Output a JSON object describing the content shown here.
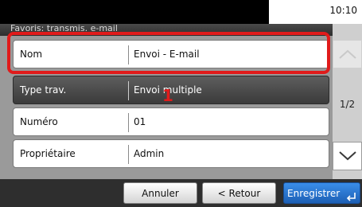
{
  "status": {
    "clock": "10:10"
  },
  "screen_title": "Favoris: transmis. e-mail",
  "rows": [
    {
      "label": "Nom",
      "value": "Envoi - E-mail",
      "selected": false
    },
    {
      "label": "Type trav.",
      "value": "Envoi multiple",
      "selected": true
    },
    {
      "label": "Numéro",
      "value": "01",
      "selected": false
    },
    {
      "label": "Propriétaire",
      "value": "Admin",
      "selected": false
    }
  ],
  "callout_number": "1",
  "pager": {
    "page": "1/2"
  },
  "icons": {
    "scroll_up": "chevron-up-icon",
    "scroll_down": "chevron-down-icon",
    "enter": "enter-icon"
  },
  "buttons": {
    "cancel": "Annuler",
    "back": "< Retour",
    "save": "Enregistrer"
  },
  "colors": {
    "highlight": "#e01b1b",
    "primary": "#2a78d6"
  }
}
